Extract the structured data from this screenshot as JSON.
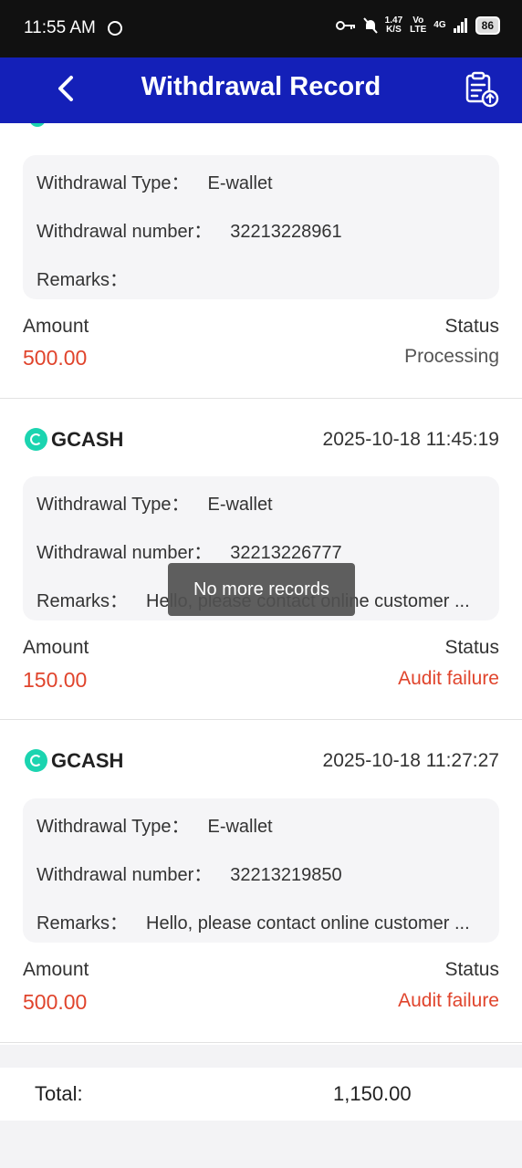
{
  "status_bar": {
    "time": "11:55 AM",
    "speed": "1.47",
    "speed_unit": "K/S",
    "volte_top": "Vo",
    "volte_bottom": "LTE",
    "network": "4G",
    "battery": "86"
  },
  "header": {
    "title": "Withdrawal Record",
    "back_icon": "chevron-left-icon",
    "action_icon": "clipboard-upload-icon"
  },
  "labels": {
    "withdrawal_type": "Withdrawal Type：",
    "withdrawal_number": "Withdrawal number：",
    "remarks": "Remarks：",
    "amount": "Amount",
    "status": "Status"
  },
  "records": [
    {
      "type": "E-wallet",
      "number": "32213228961",
      "remarks": "",
      "amount": "500.00",
      "status": "Processing"
    },
    {
      "channel": "GCASH",
      "date": "2025-10-18 11:45:19",
      "type": "E-wallet",
      "number": "32213226777",
      "remarks": "Hello, please contact online customer ...",
      "amount": "150.00",
      "status": "Audit failure"
    },
    {
      "channel": "GCASH",
      "date": "2025-10-18 11:27:27",
      "type": "E-wallet",
      "number": "32213219850",
      "remarks": "Hello, please contact online customer ...",
      "amount": "500.00",
      "status": "Audit failure"
    }
  ],
  "toast": "No more records",
  "total": {
    "label": "Total:",
    "value": "1,150.00"
  },
  "colors": {
    "header_bg": "#1420b8",
    "amount": "#e0442c",
    "failure": "#e0442c",
    "gcash_brand": "#1bd4b0"
  }
}
